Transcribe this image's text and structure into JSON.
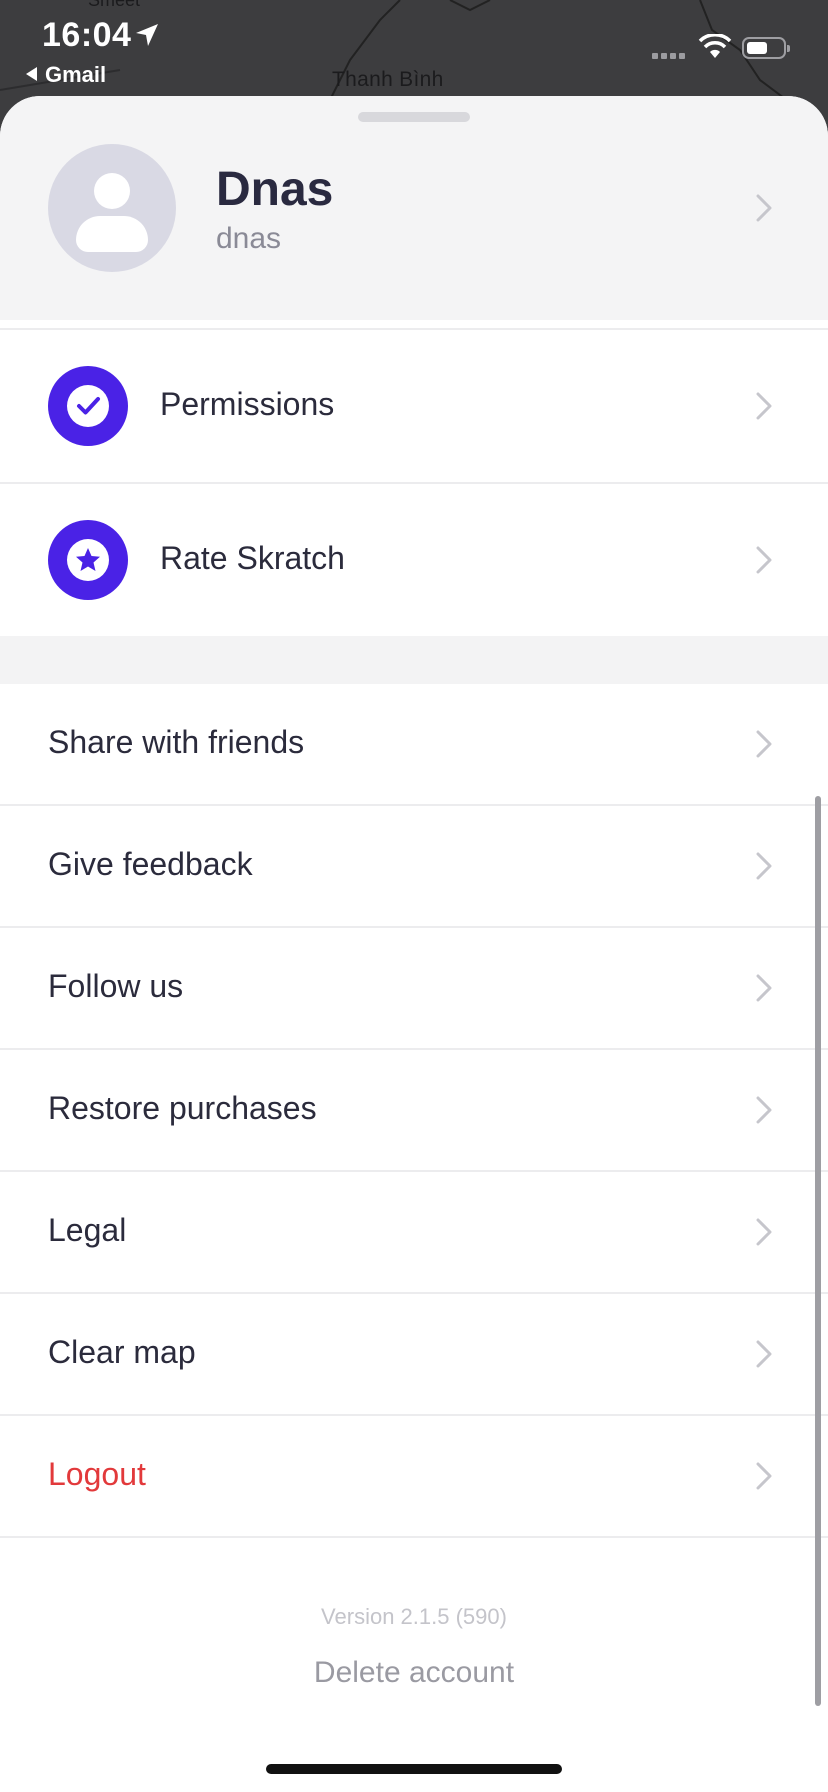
{
  "status_bar": {
    "time": "16:04",
    "back_app": "Gmail",
    "icons": [
      "location-arrow-icon",
      "cellular-signal-icon",
      "wifi-icon",
      "battery-icon"
    ]
  },
  "map": {
    "labels": [
      "Thanh Bình",
      "Smeet"
    ]
  },
  "profile": {
    "name": "Dnas",
    "handle": "dnas",
    "avatar_icon": "user-placeholder-icon"
  },
  "icon_rows": [
    {
      "label": "Permissions",
      "icon": "check-icon"
    },
    {
      "label": "Rate Skratch",
      "icon": "star-icon"
    }
  ],
  "menu": {
    "share": "Share with friends",
    "feedback": "Give feedback",
    "follow": "Follow us",
    "restore": "Restore purchases",
    "legal": "Legal",
    "clear_map": "Clear map",
    "logout": "Logout"
  },
  "footer": {
    "version": "Version 2.1.5 (590)",
    "delete_account": "Delete account"
  },
  "colors": {
    "accent": "#4a22e6",
    "danger": "#e2393b",
    "text": "#2b2b3c",
    "muted": "#8a8a96"
  }
}
